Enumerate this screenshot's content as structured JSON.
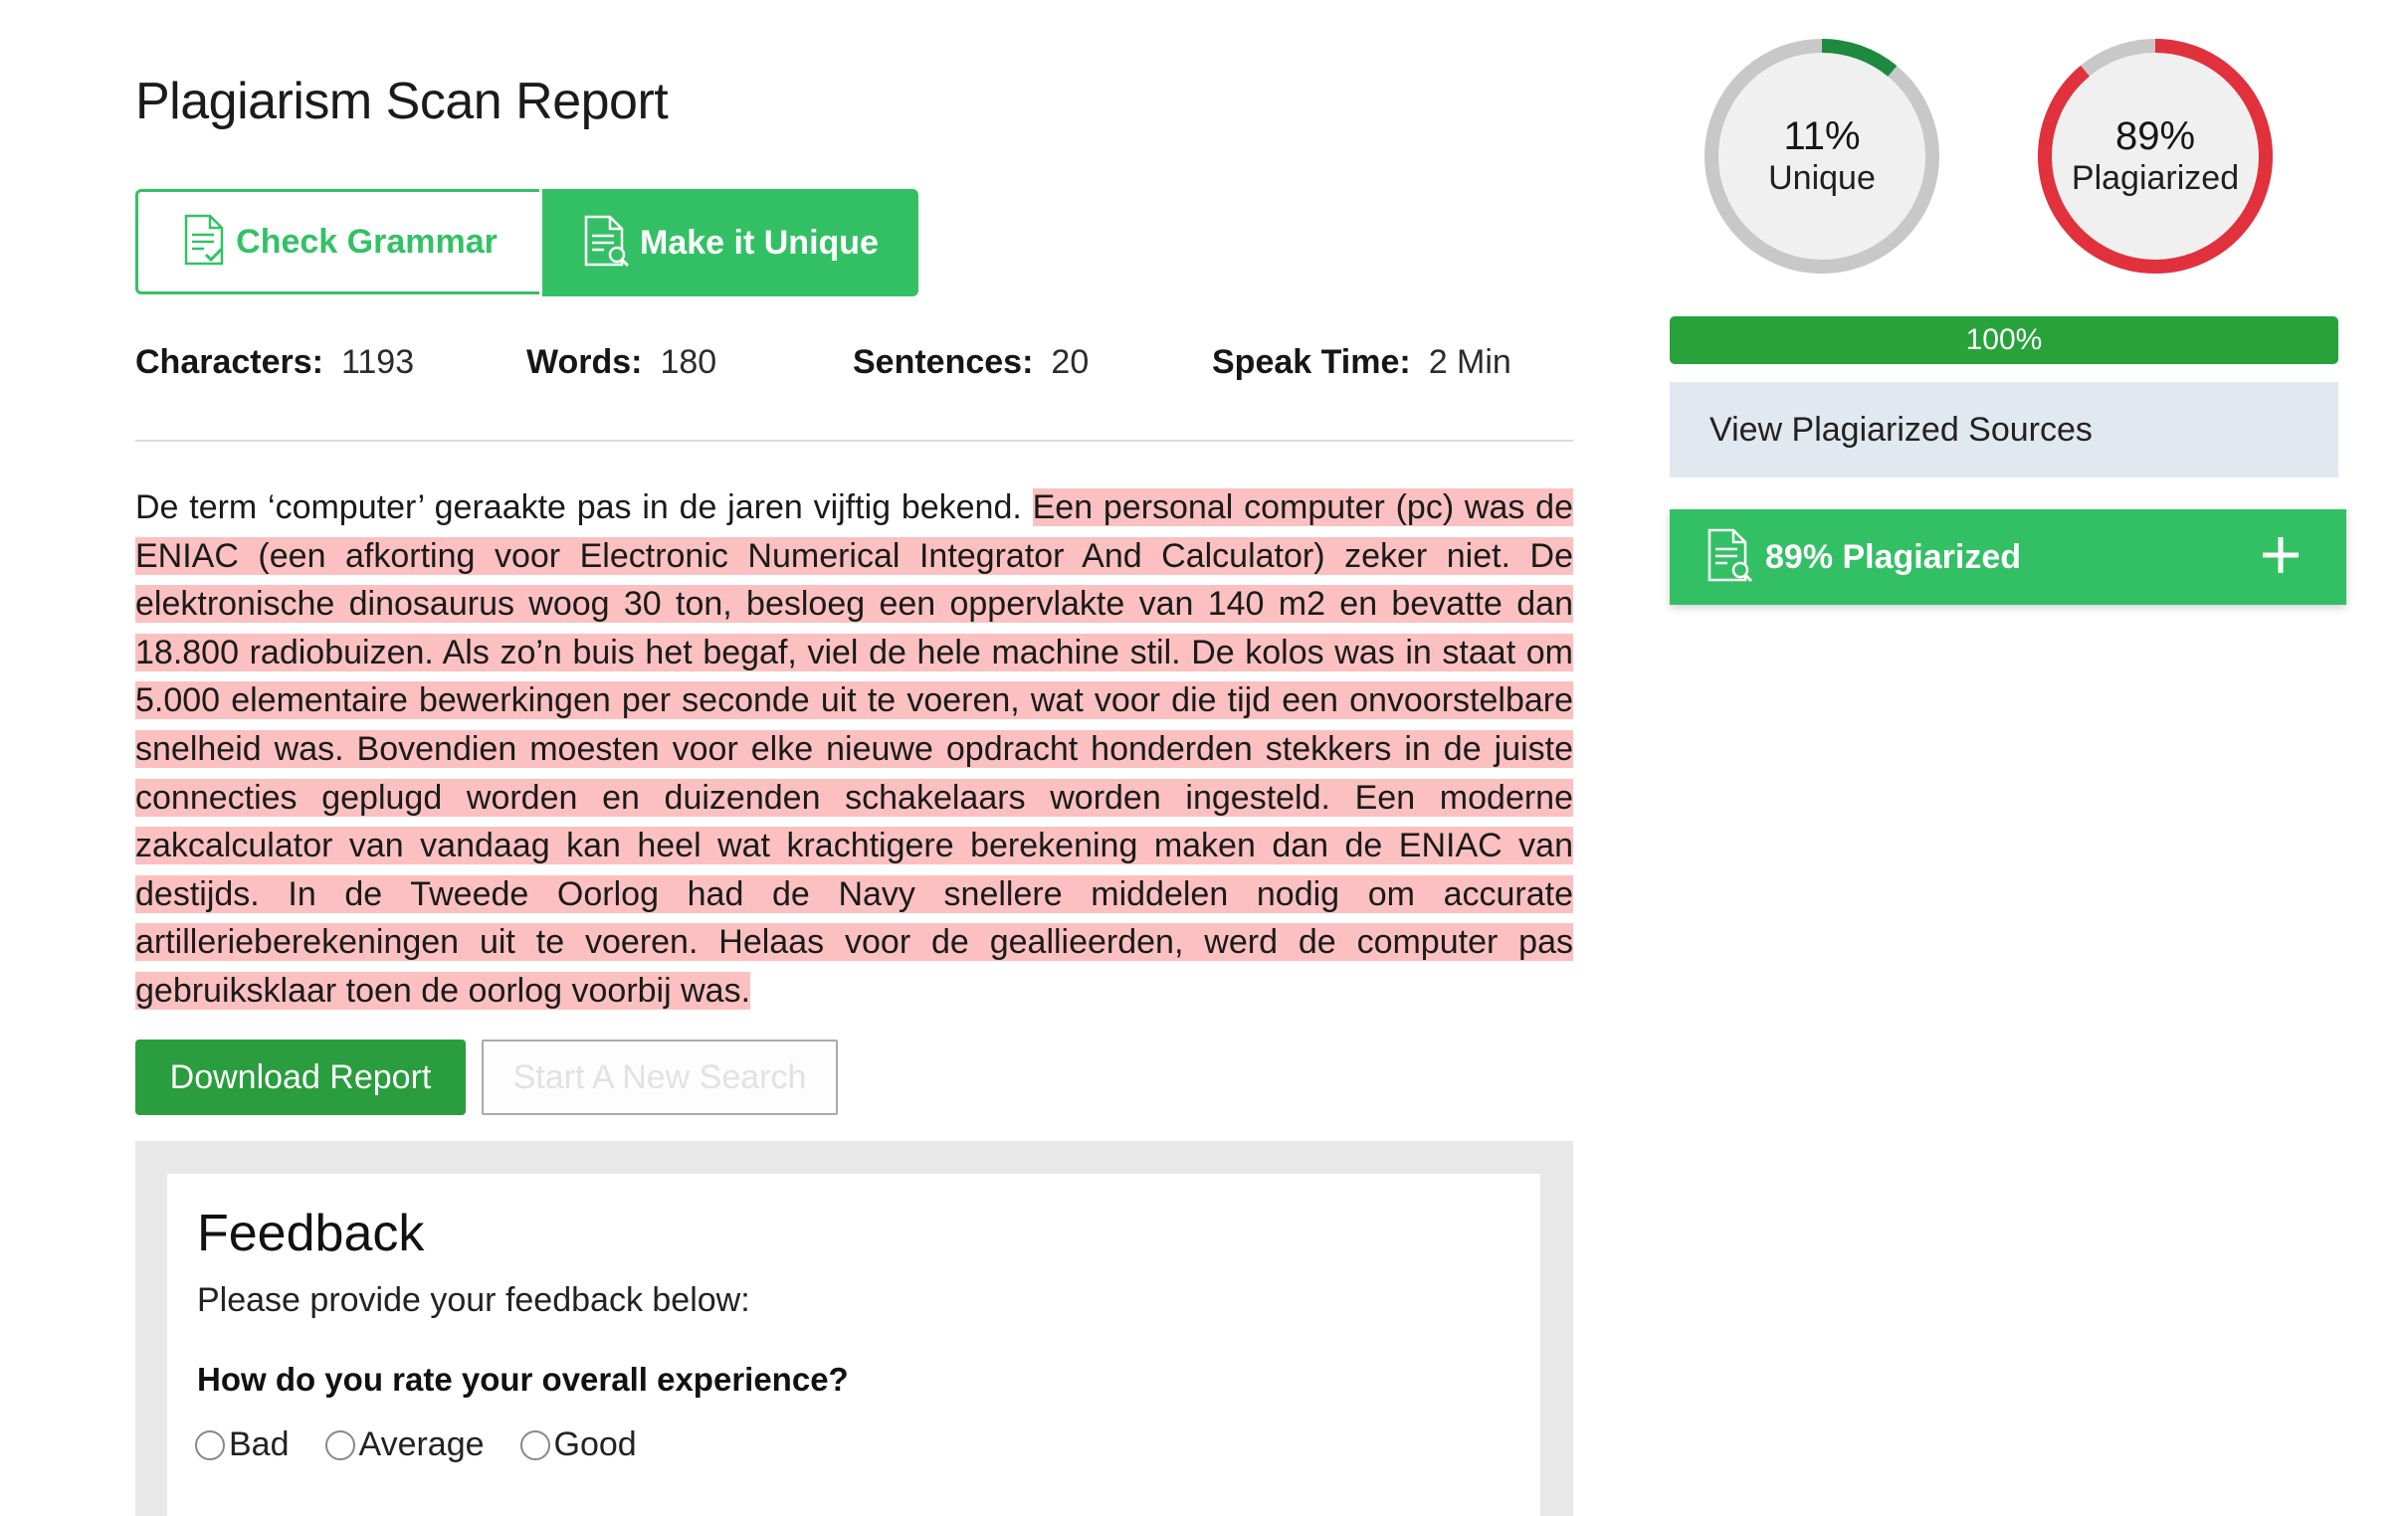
{
  "report": {
    "title": "Plagiarism Scan Report",
    "check_grammar_label": "Check Grammar",
    "make_unique_label": "Make it Unique"
  },
  "stats": {
    "characters_label": "Characters:",
    "characters_value": "1193",
    "words_label": "Words:",
    "words_value": "180",
    "sentences_label": "Sentences:",
    "sentences_value": "20",
    "speak_time_label": "Speak Time:",
    "speak_time_value": "2 Min"
  },
  "text": {
    "unique_segment": "De term ‘computer’ geraakte pas in de jaren vijftig bekend.",
    "plagiarized_segment": "Een personal computer (pc) was de ENIAC (een afkorting voor Electronic Numerical Integrator And Calculator) zeker niet. De elektronische dinosaurus woog 30 ton, besloeg een oppervlakte van 140 m2 en bevatte dan 18.800 radiobuizen. Als zo’n buis het begaf, viel de hele machine stil. De kolos was in staat om 5.000 elementaire bewerkingen per seconde uit te voeren, wat voor die tijd een onvoorstelbare snelheid was. Bovendien moesten voor elke nieuwe opdracht honderden stekkers in de juiste connecties geplugd worden en duizenden schakelaars worden ingesteld. Een moderne zakcalculator van vandaag kan heel wat krachtigere berekening maken dan de ENIAC van destijds. In de Tweede Oorlog had de Navy snellere middelen nodig om accurate artillerieberekeningen uit te voeren. Helaas voor de geallieerden, werd de computer pas gebruiksklaar toen de oorlog voorbij was."
  },
  "actions": {
    "download_label": "Download Report",
    "new_search_label": "Start A New Search"
  },
  "feedback": {
    "title": "Feedback",
    "subtitle": "Please provide your feedback below:",
    "question": "How do you rate your overall experience?",
    "options": [
      "Bad",
      "Average",
      "Good"
    ]
  },
  "gauges": {
    "unique": {
      "percent_text": "11%",
      "label": "Unique",
      "fraction": 0.11,
      "color": "#1e8a3e",
      "track": "#c8c8c8"
    },
    "plagiarized": {
      "percent_text": "89%",
      "label": "Plagiarized",
      "fraction": 0.89,
      "color": "#e0313c",
      "track": "#c8c8c8"
    }
  },
  "progress": {
    "label": "100%",
    "fraction": 1.0,
    "color": "#28a23b"
  },
  "sources": {
    "label": "View Plagiarized Sources"
  },
  "plag_summary": {
    "label": "89% Plagiarized",
    "expand_icon": "plus-icon"
  },
  "icons": {
    "grammar": "document-check-icon",
    "unique": "document-search-icon",
    "summary": "document-search-icon"
  },
  "colors": {
    "accent_green": "#33c065",
    "dark_green": "#2a9d3e",
    "highlight": "#fcc0c0"
  }
}
